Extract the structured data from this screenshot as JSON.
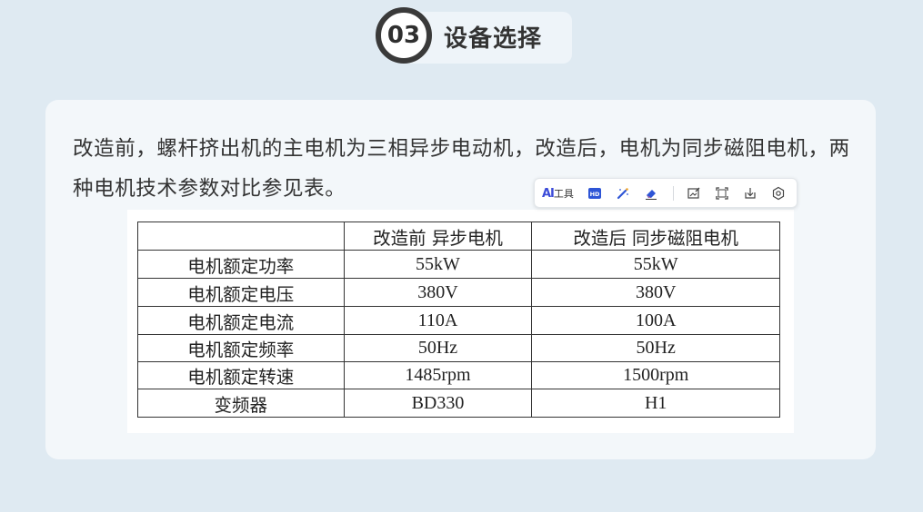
{
  "header": {
    "number": "03",
    "title": "设备选择"
  },
  "paragraph": "改造前，螺杆挤出机的主电机为三相异步电动机，改造后，电机为同步磁阻电机，两种电机技术参数对比参见表。",
  "toolbar": {
    "ai_label": "AI",
    "tool_label": "工具",
    "icons": [
      "hd-icon",
      "magic-wand-icon",
      "eraser-icon",
      "image-edit-icon",
      "crop-icon",
      "download-icon",
      "settings-icon"
    ]
  },
  "table": {
    "headers": [
      "",
      "改造前 异步电机",
      "改造后 同步磁阻电机"
    ],
    "rows": [
      [
        "电机额定功率",
        "55kW",
        "55kW"
      ],
      [
        "电机额定电压",
        "380V",
        "380V"
      ],
      [
        "电机额定电流",
        "110A",
        "100A"
      ],
      [
        "电机额定频率",
        "50Hz",
        "50Hz"
      ],
      [
        "电机额定转速",
        "1485rpm",
        "1500rpm"
      ],
      [
        "变频器",
        "BD330",
        "H1"
      ]
    ]
  }
}
